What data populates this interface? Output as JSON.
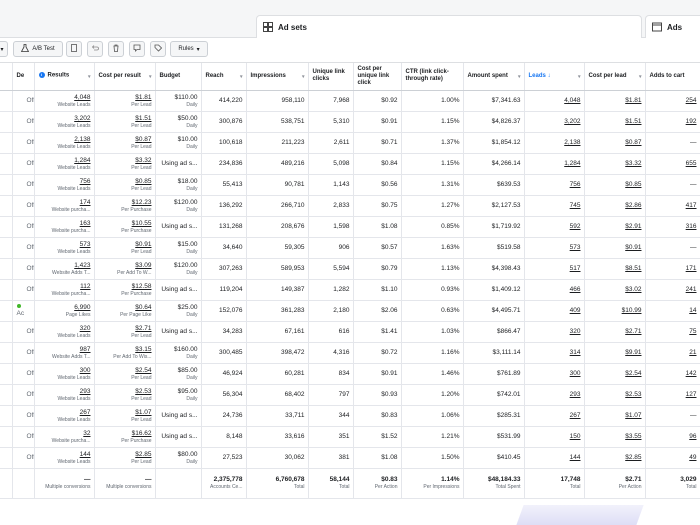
{
  "levels": {
    "adsets_label": "Ad sets",
    "ads_label": "Ads"
  },
  "toolbar": {
    "ab_test_label": "A/B Test",
    "rules_label": "Rules"
  },
  "columns": [
    "De",
    "Results",
    "Cost per result",
    "Budget",
    "Reach",
    "Impressions",
    "Unique link clicks",
    "Cost per unique link click",
    "CTR (link click-through rate)",
    "Amount spent",
    "Leads ↓",
    "Cost per lead",
    "Adds to cart"
  ],
  "rows": [
    {
      "del": "Off",
      "res": "4,048",
      "res_sub": "Website Leads",
      "cpr": "$1.81",
      "cpr_sub": "Per Lead",
      "budget": "$110.00",
      "budget_sub": "Daily",
      "reach": "414,220",
      "imp": "958,110",
      "ulc": "7,968",
      "cpulc": "$0.92",
      "ctr": "1.00%",
      "spent": "$7,341.63",
      "leads": "4,048",
      "cpl": "$1.81",
      "atc": "254"
    },
    {
      "del": "Off",
      "res": "3,202",
      "res_sub": "Website Leads",
      "cpr": "$1.51",
      "cpr_sub": "Per Lead",
      "budget": "$50.00",
      "budget_sub": "Daily",
      "reach": "300,876",
      "imp": "538,751",
      "ulc": "5,310",
      "cpulc": "$0.91",
      "ctr": "1.15%",
      "spent": "$4,826.37",
      "leads": "3,202",
      "cpl": "$1.51",
      "atc": "192"
    },
    {
      "del": "Off",
      "res": "2,138",
      "res_sub": "Website Leads",
      "cpr": "$0.87",
      "cpr_sub": "Per Lead",
      "budget": "$10.00",
      "budget_sub": "Daily",
      "reach": "100,618",
      "imp": "211,223",
      "ulc": "2,611",
      "cpulc": "$0.71",
      "ctr": "1.37%",
      "spent": "$1,854.12",
      "leads": "2,138",
      "cpl": "$0.87",
      "atc": "—"
    },
    {
      "del": "Off",
      "res": "1,284",
      "res_sub": "Website Leads",
      "cpr": "$3.32",
      "cpr_sub": "Per Lead",
      "budget": "Using ad s...",
      "budget_sub": "",
      "reach": "234,836",
      "imp": "489,216",
      "ulc": "5,098",
      "cpulc": "$0.84",
      "ctr": "1.15%",
      "spent": "$4,266.14",
      "leads": "1,284",
      "cpl": "$3.32",
      "atc": "655"
    },
    {
      "del": "Off",
      "res": "756",
      "res_sub": "Website Leads",
      "cpr": "$0.85",
      "cpr_sub": "Per Lead",
      "budget": "$18.00",
      "budget_sub": "Daily",
      "reach": "55,413",
      "imp": "90,781",
      "ulc": "1,143",
      "cpulc": "$0.56",
      "ctr": "1.31%",
      "spent": "$639.53",
      "leads": "756",
      "cpl": "$0.85",
      "atc": "—"
    },
    {
      "del": "Off",
      "res": "174",
      "res_sub": "Website purcha...",
      "cpr": "$12.23",
      "cpr_sub": "Per Purchase",
      "budget": "$120.00",
      "budget_sub": "Daily",
      "reach": "136,292",
      "imp": "266,710",
      "ulc": "2,833",
      "cpulc": "$0.75",
      "ctr": "1.27%",
      "spent": "$2,127.53",
      "leads": "745",
      "cpl": "$2.86",
      "atc": "417"
    },
    {
      "del": "Off",
      "res": "163",
      "res_sub": "Website purcha...",
      "cpr": "$10.55",
      "cpr_sub": "Per Purchase",
      "budget": "Using ad s...",
      "budget_sub": "",
      "reach": "131,268",
      "imp": "208,676",
      "ulc": "1,598",
      "cpulc": "$1.08",
      "ctr": "0.85%",
      "spent": "$1,719.92",
      "leads": "592",
      "cpl": "$2.91",
      "atc": "316"
    },
    {
      "del": "Off",
      "res": "573",
      "res_sub": "Website Leads",
      "cpr": "$0.91",
      "cpr_sub": "Per Lead",
      "budget": "$15.00",
      "budget_sub": "Daily",
      "reach": "34,640",
      "imp": "59,305",
      "ulc": "906",
      "cpulc": "$0.57",
      "ctr": "1.63%",
      "spent": "$519.58",
      "leads": "573",
      "cpl": "$0.91",
      "atc": "—"
    },
    {
      "del": "Off",
      "res": "1,423",
      "res_sub": "Website Adds T...",
      "cpr": "$3.09",
      "cpr_sub": "Per Add To W...",
      "budget": "$120.00",
      "budget_sub": "Daily",
      "reach": "307,263",
      "imp": "589,953",
      "ulc": "5,594",
      "cpulc": "$0.79",
      "ctr": "1.13%",
      "spent": "$4,398.43",
      "leads": "517",
      "cpl": "$8.51",
      "atc": "171"
    },
    {
      "del": "Off",
      "res": "112",
      "res_sub": "Website purcha...",
      "cpr": "$12.58",
      "cpr_sub": "Per Purchase",
      "budget": "Using ad s...",
      "budget_sub": "",
      "reach": "119,204",
      "imp": "149,387",
      "ulc": "1,282",
      "cpulc": "$1.10",
      "ctr": "0.93%",
      "spent": "$1,409.12",
      "leads": "466",
      "cpl": "$3.02",
      "atc": "241"
    },
    {
      "del": "Ac",
      "active": true,
      "res": "6,990",
      "res_sub": "Page Likes",
      "cpr": "$0.64",
      "cpr_sub": "Per Page Like",
      "budget": "$25.00",
      "budget_sub": "Daily",
      "reach": "152,076",
      "imp": "361,283",
      "ulc": "2,180",
      "cpulc": "$2.06",
      "ctr": "0.63%",
      "spent": "$4,495.71",
      "leads": "409",
      "cpl": "$10.99",
      "atc": "14"
    },
    {
      "del": "Off",
      "res": "320",
      "res_sub": "Website Leads",
      "cpr": "$2.71",
      "cpr_sub": "Per Lead",
      "budget": "Using ad s...",
      "budget_sub": "",
      "reach": "34,283",
      "imp": "67,161",
      "ulc": "616",
      "cpulc": "$1.41",
      "ctr": "1.03%",
      "spent": "$866.47",
      "leads": "320",
      "cpl": "$2.71",
      "atc": "75"
    },
    {
      "del": "Off",
      "res": "987",
      "res_sub": "Website Adds T...",
      "cpr": "$3.15",
      "cpr_sub": "Per Add To Wis...",
      "budget": "$160.00",
      "budget_sub": "Daily",
      "reach": "300,485",
      "imp": "398,472",
      "ulc": "4,316",
      "cpulc": "$0.72",
      "ctr": "1.16%",
      "spent": "$3,111.14",
      "leads": "314",
      "cpl": "$9.91",
      "atc": "21"
    },
    {
      "del": "Off",
      "res": "300",
      "res_sub": "Website Leads",
      "cpr": "$2.54",
      "cpr_sub": "Per Lead",
      "budget": "$85.00",
      "budget_sub": "Daily",
      "reach": "46,924",
      "imp": "60,281",
      "ulc": "834",
      "cpulc": "$0.91",
      "ctr": "1.46%",
      "spent": "$761.89",
      "leads": "300",
      "cpl": "$2.54",
      "atc": "142"
    },
    {
      "del": "Off",
      "res": "293",
      "res_sub": "Website Leads",
      "cpr": "$2.53",
      "cpr_sub": "Per Lead",
      "budget": "$95.00",
      "budget_sub": "Daily",
      "reach": "56,304",
      "imp": "68,402",
      "ulc": "797",
      "cpulc": "$0.93",
      "ctr": "1.20%",
      "spent": "$742.01",
      "leads": "293",
      "cpl": "$2.53",
      "atc": "127"
    },
    {
      "del": "Off",
      "res": "267",
      "res_sub": "Website Leads",
      "cpr": "$1.07",
      "cpr_sub": "Per Lead",
      "budget": "Using ad s...",
      "budget_sub": "",
      "reach": "24,736",
      "imp": "33,711",
      "ulc": "344",
      "cpulc": "$0.83",
      "ctr": "1.06%",
      "spent": "$285.31",
      "leads": "267",
      "cpl": "$1.07",
      "atc": "—"
    },
    {
      "del": "Off",
      "res": "32",
      "res_sub": "Website purcha...",
      "cpr": "$16.62",
      "cpr_sub": "Per Purchase",
      "budget": "Using ad s...",
      "budget_sub": "",
      "reach": "8,148",
      "imp": "33,616",
      "ulc": "351",
      "cpulc": "$1.52",
      "ctr": "1.21%",
      "spent": "$531.99",
      "leads": "150",
      "cpl": "$3.55",
      "atc": "96"
    },
    {
      "del": "Off",
      "res": "144",
      "res_sub": "Website Leads",
      "cpr": "$2.85",
      "cpr_sub": "Per Lead",
      "budget": "$80.00",
      "budget_sub": "Daily",
      "reach": "27,523",
      "imp": "30,062",
      "ulc": "381",
      "cpulc": "$1.08",
      "ctr": "1.50%",
      "spent": "$410.45",
      "leads": "144",
      "cpl": "$2.85",
      "atc": "49"
    }
  ],
  "totals": {
    "res": "—",
    "res_sub": "Multiple conversions",
    "cpr": "—",
    "cpr_sub": "Multiple conversions",
    "reach": "2,375,778",
    "reach_sub": "Accounts Ce...",
    "imp": "6,760,678",
    "imp_sub": "Total",
    "ulc": "58,144",
    "ulc_sub": "Total",
    "cpulc": "$0.83",
    "cpulc_sub": "Per Action",
    "ctr": "1.14%",
    "ctr_sub": "Per Impressions",
    "spent": "$48,184.33",
    "spent_sub": "Total Spent",
    "leads": "17,748",
    "leads_sub": "Total",
    "cpl": "$2.71",
    "cpl_sub": "Per Action",
    "atc": "3,029",
    "atc_sub": "Total"
  },
  "colors": {
    "accent": "#1877f2",
    "active": "#42b72a"
  }
}
